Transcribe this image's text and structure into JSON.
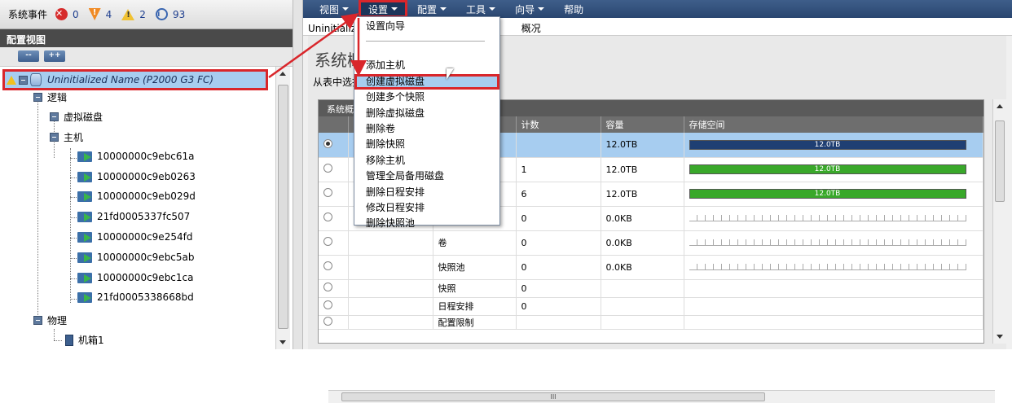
{
  "events": {
    "label": "系统事件",
    "error_count": "0",
    "critical_count": "4",
    "warning_count": "2",
    "info_count": "93"
  },
  "config_view": {
    "title": "配置视图",
    "collapse_btn": "--",
    "expand_btn": "++"
  },
  "tree": {
    "root": "Uninitialized Name (P2000 G3 FC)",
    "logic": "逻辑",
    "vdisk": "虚拟磁盘",
    "hosts": "主机",
    "host_items": [
      "10000000c9ebc61a",
      "10000000c9eb0263",
      "10000000c9eb029d",
      "21fd0005337fc507",
      "10000000c9e254fd",
      "10000000c9ebc5ab",
      "10000000c9ebc1ca",
      "21fd0005338668bd"
    ],
    "physical": "物理",
    "enclosure": "机箱1"
  },
  "menu": {
    "items": [
      "视图",
      "设置",
      "配置",
      "工具",
      "向导",
      "帮助"
    ]
  },
  "breadcrumb": {
    "left": "Uninitializ",
    "right": "概况"
  },
  "main": {
    "title": "系统概",
    "hint": "从表中选择"
  },
  "panel": {
    "title": "系统概",
    "headers": [
      "",
      "",
      "",
      "计数",
      "容量",
      "存储空间"
    ],
    "rows": [
      {
        "name": "",
        "count": "",
        "capacity": "12.0TB",
        "bar": "12.0TB"
      },
      {
        "name": "",
        "count": "1",
        "capacity": "12.0TB",
        "bar": "12.0TB"
      },
      {
        "name": "",
        "count": "6",
        "capacity": "12.0TB",
        "bar": "12.0TB"
      },
      {
        "name": "",
        "count": "0",
        "capacity": "0.0KB",
        "bar": ""
      },
      {
        "name": "卷",
        "count": "0",
        "capacity": "0.0KB",
        "bar": ""
      },
      {
        "name": "快照池",
        "count": "0",
        "capacity": "0.0KB",
        "bar": ""
      },
      {
        "name": "快照",
        "count": "0",
        "capacity": "",
        "bar": ""
      },
      {
        "name": "日程安排",
        "count": "0",
        "capacity": "",
        "bar": ""
      },
      {
        "name": "配置限制",
        "count": "",
        "capacity": "",
        "bar": ""
      }
    ],
    "hscroll_grip": "III"
  },
  "dropdown": {
    "items": [
      "设置向导",
      "添加主机",
      "创建虚拟磁盘",
      "创建多个快照",
      "删除虚拟磁盘",
      "删除卷",
      "删除快照",
      "移除主机",
      "管理全局备用磁盘",
      "删除日程安排",
      "修改日程安排",
      "删除快照池"
    ]
  },
  "colors": {
    "highlight_border": "#d9262b",
    "selection": "#a7cdf0",
    "menubar": "#2a4670",
    "bar_used_navy": "#1f3f73",
    "bar_used_green": "#39a82a"
  }
}
